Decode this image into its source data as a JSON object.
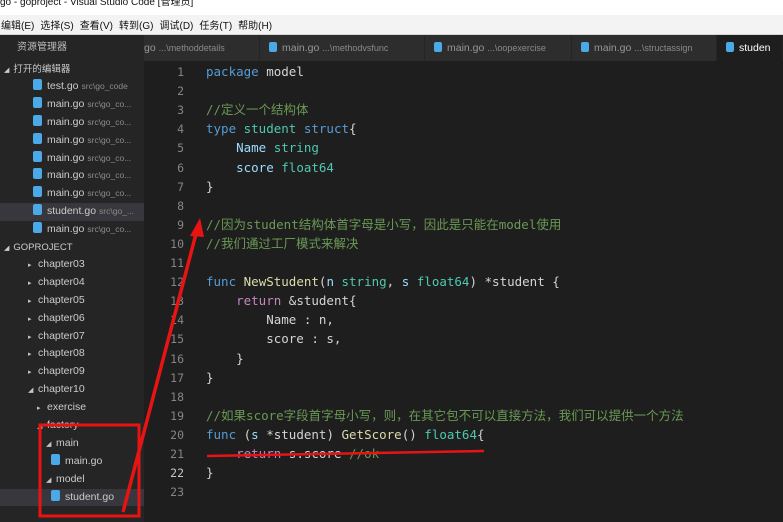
{
  "window": {
    "title": "go - goproject - Visual Studio Code [管理员]"
  },
  "menu": [
    "编辑(E)",
    "选择(S)",
    "查看(V)",
    "转到(G)",
    "调试(D)",
    "任务(T)",
    "帮助(H)"
  ],
  "explorer": {
    "header": "资源管理器",
    "open_editors_label": "打开的编辑器",
    "open_editors": [
      {
        "name": "test.go",
        "path": "src\\go_code"
      },
      {
        "name": "main.go",
        "path": "src\\go_co..."
      },
      {
        "name": "main.go",
        "path": "src\\go_co..."
      },
      {
        "name": "main.go",
        "path": "src\\go_co..."
      },
      {
        "name": "main.go",
        "path": "src\\go_co..."
      },
      {
        "name": "main.go",
        "path": "src\\go_co..."
      },
      {
        "name": "main.go",
        "path": "src\\go_co..."
      },
      {
        "name": "student.go",
        "path": "src\\go_..."
      },
      {
        "name": "main.go",
        "path": "src\\go_co..."
      }
    ],
    "project_label": "GOPROJECT",
    "folders": [
      {
        "name": "chapter03",
        "arrow": "▸",
        "level": 1
      },
      {
        "name": "chapter04",
        "arrow": "▸",
        "level": 1
      },
      {
        "name": "chapter05",
        "arrow": "▸",
        "level": 1
      },
      {
        "name": "chapter06",
        "arrow": "▸",
        "level": 1
      },
      {
        "name": "chapter07",
        "arrow": "▸",
        "level": 1
      },
      {
        "name": "chapter08",
        "arrow": "▸",
        "level": 1
      },
      {
        "name": "chapter09",
        "arrow": "▸",
        "level": 1
      },
      {
        "name": "chapter10",
        "arrow": "◢",
        "level": 1
      },
      {
        "name": "exercise",
        "arrow": "▸",
        "level": 2
      },
      {
        "name": "factory",
        "arrow": "◢",
        "level": 2
      },
      {
        "name": "main",
        "arrow": "◢",
        "level": 3
      },
      {
        "name": "main.go",
        "arrow": "",
        "level": 4,
        "file": true
      },
      {
        "name": "model",
        "arrow": "◢",
        "level": 3
      },
      {
        "name": "student.go",
        "arrow": "",
        "level": 4,
        "file": true,
        "selected": true
      }
    ]
  },
  "tabs": [
    {
      "name": "go",
      "path": "...\\methoddetails"
    },
    {
      "name": "main.go",
      "path": "...\\methodvsfunc"
    },
    {
      "name": "main.go",
      "path": "...\\oopexercise"
    },
    {
      "name": "main.go",
      "path": "...\\structassign"
    },
    {
      "name": "studen",
      "path": ""
    }
  ],
  "code": [
    {
      "n": "1",
      "t": [
        [
          "package",
          "#569cd6"
        ],
        [
          " model",
          "#d4d4d4"
        ]
      ]
    },
    {
      "n": "2",
      "t": []
    },
    {
      "n": "3",
      "t": [
        [
          "//定义一个结构体",
          "#6a9955"
        ]
      ]
    },
    {
      "n": "4",
      "t": [
        [
          "type",
          "#569cd6"
        ],
        [
          " student ",
          "#4ec9b0"
        ],
        [
          "struct",
          "#569cd6"
        ],
        [
          "{",
          "#d4d4d4"
        ]
      ]
    },
    {
      "n": "5",
      "t": [
        [
          "    Name ",
          "#9cdcfe"
        ],
        [
          "string",
          "#4ec9b0"
        ]
      ]
    },
    {
      "n": "6",
      "t": [
        [
          "    score ",
          "#9cdcfe"
        ],
        [
          "float64",
          "#4ec9b0"
        ]
      ]
    },
    {
      "n": "7",
      "t": [
        [
          "}",
          "#d4d4d4"
        ]
      ]
    },
    {
      "n": "8",
      "t": []
    },
    {
      "n": "9",
      "t": [
        [
          "//因为student结构体首字母是小写，因此是只能在model使用",
          "#6a9955"
        ]
      ]
    },
    {
      "n": "10",
      "t": [
        [
          "//我们通过工厂模式来解决",
          "#6a9955"
        ]
      ]
    },
    {
      "n": "11",
      "t": []
    },
    {
      "n": "12",
      "t": [
        [
          "func",
          "#569cd6"
        ],
        [
          " ",
          "#d4d4d4"
        ],
        [
          "NewStudent",
          "#dcdcaa"
        ],
        [
          "(",
          "#d4d4d4"
        ],
        [
          "n ",
          "#9cdcfe"
        ],
        [
          "string",
          "#4ec9b0"
        ],
        [
          ", ",
          "#d4d4d4"
        ],
        [
          "s ",
          "#9cdcfe"
        ],
        [
          "float64",
          "#4ec9b0"
        ],
        [
          ") *student {",
          "#d4d4d4"
        ]
      ]
    },
    {
      "n": "13",
      "t": [
        [
          "    ",
          "#d4d4d4"
        ],
        [
          "return",
          "#c586c0"
        ],
        [
          " &student{",
          "#d4d4d4"
        ]
      ]
    },
    {
      "n": "14",
      "t": [
        [
          "        Name : n,",
          "#d4d4d4"
        ]
      ]
    },
    {
      "n": "15",
      "t": [
        [
          "        score : s,",
          "#d4d4d4"
        ]
      ]
    },
    {
      "n": "16",
      "t": [
        [
          "    }",
          "#d4d4d4"
        ]
      ]
    },
    {
      "n": "17",
      "t": [
        [
          "}",
          "#d4d4d4"
        ]
      ]
    },
    {
      "n": "18",
      "t": []
    },
    {
      "n": "19",
      "t": [
        [
          "//如果score字段首字母小写，则，在其它包不可以直接方法，我们可以提供一个方法",
          "#6a9955"
        ]
      ]
    },
    {
      "n": "20",
      "t": [
        [
          "func",
          "#569cd6"
        ],
        [
          " (",
          "#d4d4d4"
        ],
        [
          "s ",
          "#9cdcfe"
        ],
        [
          "*student) ",
          "#d4d4d4"
        ],
        [
          "GetScore",
          "#dcdcaa"
        ],
        [
          "() ",
          "#d4d4d4"
        ],
        [
          "float64",
          "#4ec9b0"
        ],
        [
          "{",
          "#d4d4d4"
        ]
      ]
    },
    {
      "n": "21",
      "t": [
        [
          "    ",
          "#d4d4d4"
        ],
        [
          "return",
          "#c586c0"
        ],
        [
          " s.score ",
          "#d4d4d4"
        ],
        [
          "//ok",
          "#6a9955"
        ]
      ]
    },
    {
      "n": "22",
      "t": [
        [
          "}",
          "#d4d4d4"
        ]
      ]
    },
    {
      "n": "23",
      "t": []
    }
  ],
  "current_line": "22",
  "annotation_color": "#e81414"
}
